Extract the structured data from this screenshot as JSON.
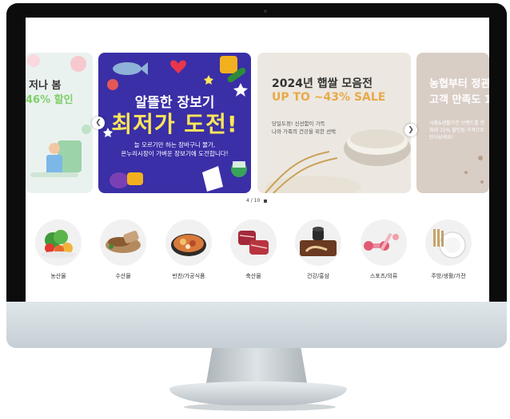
{
  "banners": [
    {
      "head1": "저나 봄",
      "head2": "46% 할인"
    },
    {
      "head1": "알뜰한 장보기",
      "head2": "최저가 도전!",
      "sub1": "늘 오르기만 하는 장바구니 물가,",
      "sub2": "온누리시장이 가벼운 장보기에 도전합니다!"
    },
    {
      "head1": "2024년 햅쌀 모음전",
      "head2": "UP TO ~43% SALE",
      "sub1": "당일도정! 신선함이 가득",
      "sub2": "나와 가족의 건강을 위한 선택"
    },
    {
      "head1": "농협부터 정관",
      "head2": "고객 만족도 1",
      "sub1": "식품&생활가전 브랜드를 한",
      "sub2": "최대 72% 할인된 가격으로",
      "sub3": "만나보세요!"
    }
  ],
  "carousel": {
    "indicator": "4 / 10",
    "prev_icon": "chevron-left-icon",
    "next_icon": "chevron-right-icon",
    "pause_icon": "pause-icon"
  },
  "categories": [
    {
      "label": "농산물"
    },
    {
      "label": "수산물"
    },
    {
      "label": "반찬/가공식품"
    },
    {
      "label": "축산물"
    },
    {
      "label": "건강/홍삼"
    },
    {
      "label": "스포츠/의류"
    },
    {
      "label": "주방/생활/가전"
    }
  ]
}
